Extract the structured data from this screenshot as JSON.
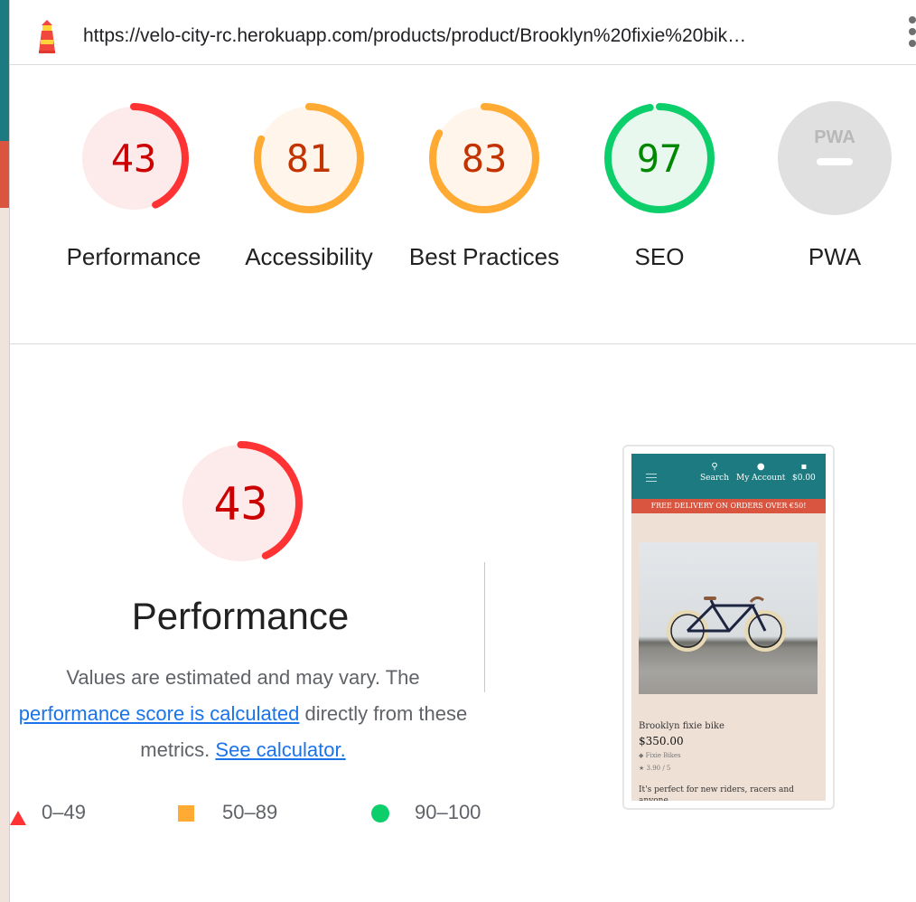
{
  "url": "https://velo-city-rc.herokuapp.com/products/product/Brooklyn%20fixie%20bik…",
  "colors": {
    "fail": "#ff3333",
    "fail_text": "#cc0000",
    "fail_bg": "#fdeaea",
    "average": "#ffaa33",
    "average_text": "#c33300",
    "average_bg": "#fff5eb",
    "pass": "#0cce6b",
    "pass_text": "#008800",
    "pass_bg": "#e8f8ef",
    "pwa_bg": "#e0e0e0",
    "link": "#1a73e8"
  },
  "gauges": [
    {
      "label": "Performance",
      "score": 43,
      "status": "fail"
    },
    {
      "label": "Accessibility",
      "score": 81,
      "status": "average"
    },
    {
      "label": "Best Practices",
      "score": 83,
      "status": "average"
    },
    {
      "label": "SEO",
      "score": 97,
      "status": "pass"
    },
    {
      "label": "PWA",
      "badge": "PWA"
    }
  ],
  "performance": {
    "score": 43,
    "title": "Performance",
    "desc_before": "Values are estimated and may vary. The ",
    "desc_link1": "performance score is calculated",
    "desc_middle": " directly from these metrics. ",
    "desc_link2": "See calculator."
  },
  "legend": {
    "fail_range": "0–49",
    "average_range": "50–89",
    "pass_range": "90–100"
  },
  "screenshot": {
    "nav_search": "Search",
    "nav_account": "My Account",
    "nav_cart": "$0.00",
    "promo": "FREE DELIVERY ON ORDERS OVER €50!",
    "product_title": "Brooklyn fixie bike",
    "product_price": "$350.00",
    "product_category": "Fixie Bikes",
    "product_rating": "3.90 / 5",
    "product_desc": "It's perfect for new riders, racers and anyone"
  }
}
